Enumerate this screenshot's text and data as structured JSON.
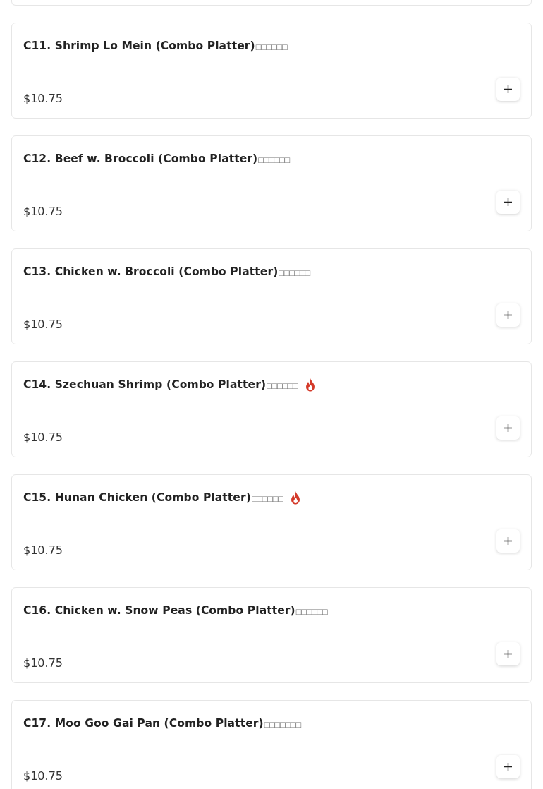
{
  "items": [
    {
      "title": "C11. Shrimp Lo Mein (Combo Platter)",
      "suffix": "□□□□□□",
      "spicy": false,
      "price": "$10.75"
    },
    {
      "title": "C12. Beef w. Broccoli (Combo Platter)",
      "suffix": "□□□□□□",
      "spicy": false,
      "price": "$10.75"
    },
    {
      "title": "C13. Chicken w. Broccoli (Combo Platter)",
      "suffix": "□□□□□□",
      "spicy": false,
      "price": "$10.75"
    },
    {
      "title": "C14. Szechuan Shrimp (Combo Platter)",
      "suffix": "□□□□□□",
      "spicy": true,
      "price": "$10.75"
    },
    {
      "title": "C15. Hunan Chicken (Combo Platter)",
      "suffix": "□□□□□□",
      "spicy": true,
      "price": "$10.75"
    },
    {
      "title": "C16. Chicken w. Snow Peas (Combo Platter)",
      "suffix": "□□□□□□",
      "spicy": false,
      "price": "$10.75"
    },
    {
      "title": "C17. Moo Goo Gai Pan (Combo Platter)",
      "suffix": "□□□□□□□",
      "spicy": false,
      "price": "$10.75"
    }
  ]
}
